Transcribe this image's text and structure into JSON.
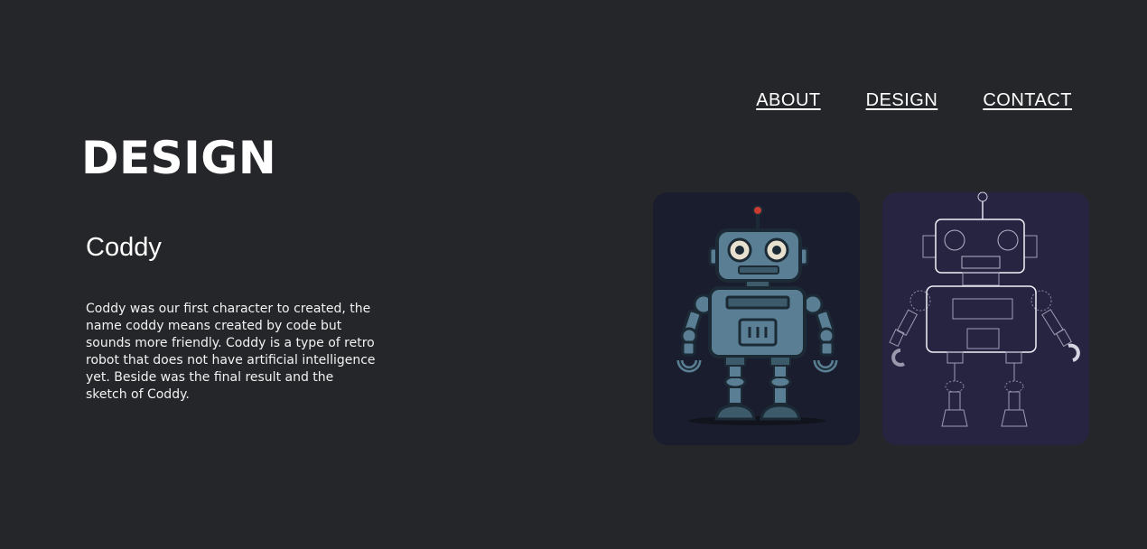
{
  "nav": {
    "items": [
      {
        "label": "ABOUT"
      },
      {
        "label": "DESIGN"
      },
      {
        "label": "CONTACT"
      }
    ]
  },
  "page": {
    "title": "DESIGN"
  },
  "character": {
    "name": "Coddy",
    "description": "Coddy was our first character to created, the name coddy means created by code but sounds more friendly. Coddy is a type of retro robot that does not have artificial intelligence yet. Beside was the final result and the sketch of Coddy."
  },
  "colors": {
    "background": "#252629",
    "card_final": "#1a1d2e",
    "card_sketch": "#262440",
    "robot_body": "#5a7f94",
    "robot_dark": "#1c2a36",
    "antenna_tip": "#c93a32"
  }
}
